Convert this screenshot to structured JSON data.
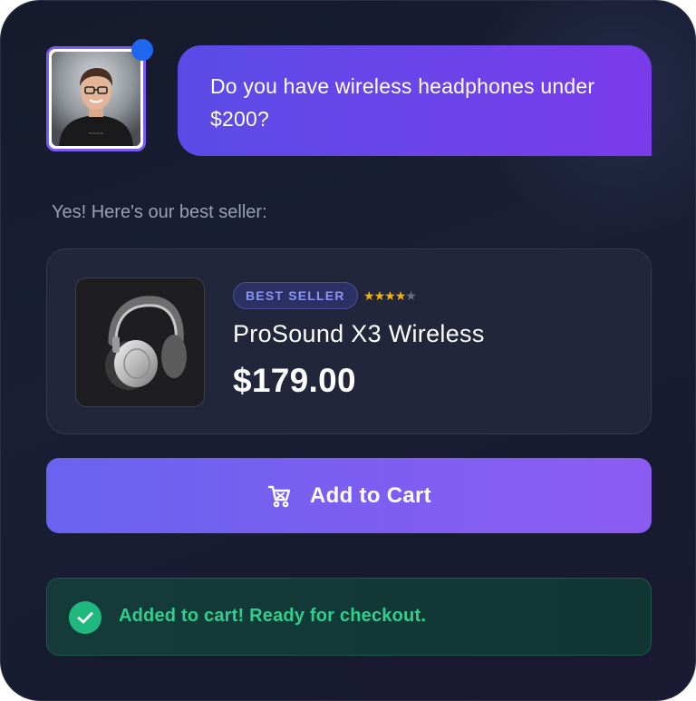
{
  "chat": {
    "user_message": "Do you have wireless headphones under $200?",
    "assistant_reply": "Yes! Here's our best seller:"
  },
  "product": {
    "badge": "BEST SELLER",
    "rating": 4,
    "rating_max": 5,
    "name": "ProSound X3 Wireless",
    "price": "$179.00"
  },
  "actions": {
    "add_to_cart_label": "Add to Cart"
  },
  "toast": {
    "message": "Added to cart! Ready for checkout."
  },
  "icons": {
    "cart": "cart-icon",
    "check": "check-circle-icon",
    "status": "online-status-icon"
  },
  "colors": {
    "accent": "#6a63f0",
    "bubble": "#6a45ea",
    "success": "#2fcf8e",
    "star": "#f5b400",
    "status_dot": "#1f66f0"
  }
}
